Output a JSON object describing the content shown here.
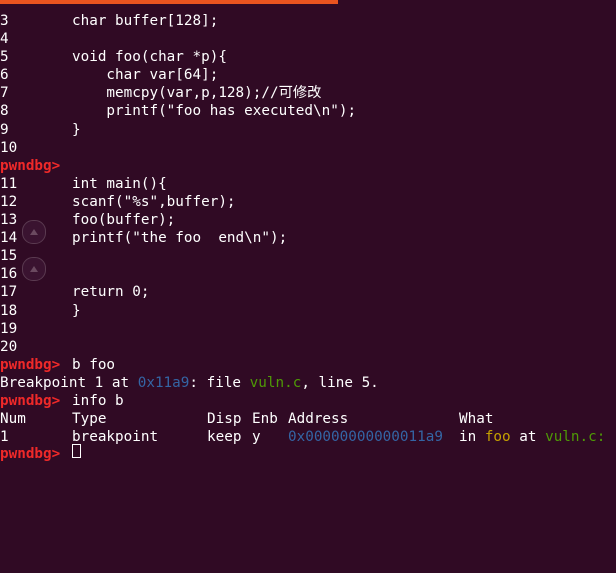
{
  "colors": {
    "background": "#300a24",
    "text": "#ffffff",
    "prompt": "#ef2929",
    "filename": "#4e9a06",
    "address": "#3465a4",
    "function": "#c4a000",
    "progress": "#e9541f"
  },
  "source_lines": [
    {
      "n": "3",
      "code": "char buffer[128];"
    },
    {
      "n": "4",
      "code": ""
    },
    {
      "n": "5",
      "code": "void foo(char *p){"
    },
    {
      "n": "6",
      "code": "    char var[64];"
    },
    {
      "n": "7",
      "code": "    memcpy(var,p,128);//可修改"
    },
    {
      "n": "8",
      "code": "    printf(\"foo has executed\\n\");"
    },
    {
      "n": "9",
      "code": "}"
    },
    {
      "n": "10",
      "code": ""
    }
  ],
  "prompt": "pwndbg>",
  "source_lines_2": [
    {
      "n": "11",
      "code": "int main(){"
    },
    {
      "n": "12",
      "code": "scanf(\"%s\",buffer);"
    },
    {
      "n": "13",
      "code": "foo(buffer);"
    },
    {
      "n": "14",
      "code": "printf(\"the foo  end\\n\");"
    },
    {
      "n": "15",
      "code": ""
    },
    {
      "n": "16",
      "code": ""
    },
    {
      "n": "17",
      "code": "return 0;"
    },
    {
      "n": "18",
      "code": "}"
    },
    {
      "n": "19",
      "code": ""
    },
    {
      "n": "20",
      "code": ""
    }
  ],
  "commands": {
    "break_cmd": "b foo",
    "break_result": {
      "prefix": "Breakpoint 1 at ",
      "address": "0x11a9",
      "mid": ": file ",
      "file": "vuln.c",
      "suffix": ", line 5."
    },
    "info_cmd": "info b"
  },
  "table": {
    "headers": {
      "num": "Num",
      "type": "Type",
      "disp": "Disp",
      "enb": "Enb",
      "address": "Address",
      "what": "What"
    },
    "row": {
      "num": "1",
      "type": "breakpoint",
      "disp": "keep",
      "enb": "y",
      "address": "0x00000000000011a9",
      "what_prefix": "in ",
      "what_func": "foo",
      "what_mid": " at ",
      "what_file": "vuln.c:"
    }
  },
  "icons": {
    "gutter_button_1": "triangle-up-icon",
    "gutter_button_2": "triangle-up-icon"
  }
}
